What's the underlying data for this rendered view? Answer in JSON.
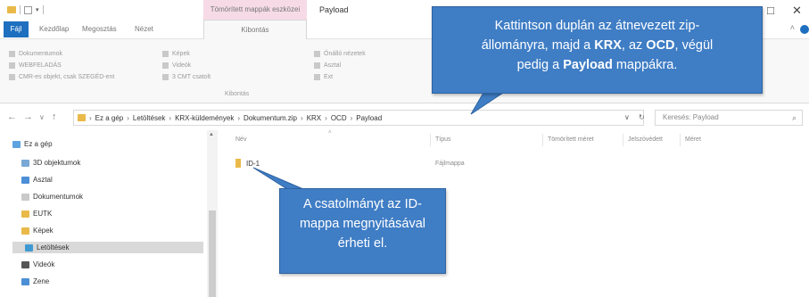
{
  "titlebar": {
    "context_tab": "Tömörített mappák eszközei",
    "window_title": "Payload",
    "maximize_glyph": "□",
    "close_glyph": "✕"
  },
  "ribbon_tabs": {
    "file": "Fájl",
    "home": "Kezdőlap",
    "share": "Megosztás",
    "view": "Nézet",
    "extract": "Kibontás"
  },
  "ribbon": {
    "items_col1": [
      "Dokumentumok",
      "WEBFELADÁS",
      "CMR-es objekt, csak SZEGÉD-ent"
    ],
    "items_col2": [
      "Képek",
      "Videók",
      "3 CMT csatolt"
    ],
    "items_col3": [
      "Önálló nézetek",
      "Asztal",
      "Ext"
    ],
    "group_label": "Kibontás"
  },
  "address": {
    "segments": [
      "Ez a gép",
      "Letöltések",
      "KRX-küldemények",
      "Dokumentum.zip",
      "KRX",
      "OCD",
      "Payload"
    ],
    "refresh_glyph": "↻",
    "search_placeholder": "Keresés: Payload"
  },
  "nav_pane": {
    "items": [
      {
        "label": "Ez a gép",
        "color": "#5da3e0"
      },
      {
        "label": "3D objektumok",
        "color": "#7aa9d6"
      },
      {
        "label": "Asztal",
        "color": "#4c8fd6"
      },
      {
        "label": "Dokumentumok",
        "color": "#c9c9c9"
      },
      {
        "label": "EUTK",
        "color": "#e9b949"
      },
      {
        "label": "Képek",
        "color": "#e9b949"
      },
      {
        "label": "Letöltések",
        "color": "#3f9ad1"
      },
      {
        "label": "Videók",
        "color": "#555555"
      },
      {
        "label": "Zene",
        "color": "#4c8fd6"
      }
    ],
    "selected_index": 6
  },
  "file_list": {
    "columns": {
      "name": "Név",
      "type": "Típus",
      "compressed": "Tömörített méret",
      "protected": "Jelszóvédett",
      "size": "Méret"
    },
    "rows": [
      {
        "name": "ID-1",
        "type": "Fájlmappa"
      }
    ]
  },
  "callouts": {
    "top_line1": "Kattintson duplán az átnevezett zip-",
    "top_line2_a": "állományra, majd a ",
    "top_krx": "KRX",
    "top_line2_b": ", az ",
    "top_ocd": "OCD",
    "top_line2_c": ", végül",
    "top_line3_a": "pedig a ",
    "top_payload": "Payload",
    "top_line3_b": " mappákra.",
    "bottom_line1": "A csatolmányt az ID-",
    "bottom_line2": "mappa megnyitásával",
    "bottom_line3": "érheti el."
  }
}
